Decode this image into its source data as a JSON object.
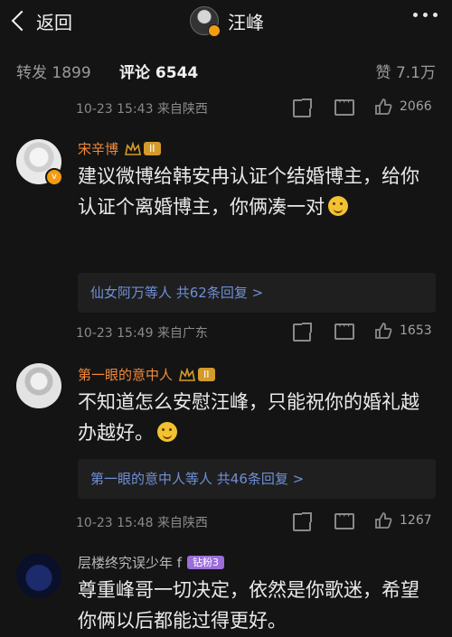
{
  "header": {
    "back_label": "返回",
    "title": "汪峰"
  },
  "stats": {
    "reposts": "转发 1899",
    "comments": "评论 6544",
    "likes": "赞 7.1万"
  },
  "comments": [
    {
      "time": "10-23 15:43",
      "location": "来自陕西",
      "likes": "2066"
    },
    {
      "username": "宋辛博",
      "level": "II",
      "text": "建议微博给韩安冉认证个结婚博主，给你认证个离婚博主，你俩凑一对",
      "replies": "仙女阿万等人 共62条回复 >",
      "time": "10-23 15:49",
      "location": "来自广东",
      "likes": "1653"
    },
    {
      "username": "第一眼的意中人",
      "level": "II",
      "text": "不知道怎么安慰汪峰，只能祝你的婚礼越办越好。",
      "replies": "第一眼的意中人等人 共46条回复 >",
      "time": "10-23 15:48",
      "location": "来自陕西",
      "likes": "1267"
    },
    {
      "username": "层楼终究误少年 f",
      "level": "钻粉3",
      "text": "尊重峰哥一切决定，依然是你歌迷，希望你俩以后都能过得更好。"
    }
  ],
  "colors": {
    "background": "#141414",
    "username": "#f08a3c",
    "link": "#6f8fd6"
  }
}
